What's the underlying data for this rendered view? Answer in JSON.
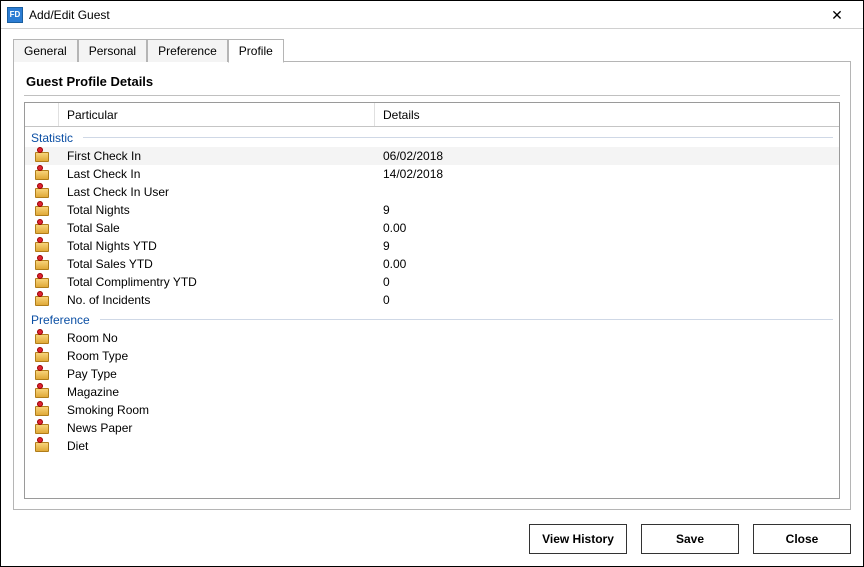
{
  "window": {
    "title": "Add/Edit Guest",
    "app_icon_text": "FD"
  },
  "tabs": [
    {
      "label": "General"
    },
    {
      "label": "Personal"
    },
    {
      "label": "Preference"
    },
    {
      "label": "Profile"
    }
  ],
  "active_tab_index": 3,
  "panel": {
    "title": "Guest Profile Details",
    "columns": {
      "particular": "Particular",
      "details": "Details"
    },
    "groups": [
      {
        "name": "Statistic",
        "rows": [
          {
            "particular": "First Check In",
            "details": "06/02/2018"
          },
          {
            "particular": "Last Check In",
            "details": "14/02/2018"
          },
          {
            "particular": "Last Check In User",
            "details": ""
          },
          {
            "particular": "Total Nights",
            "details": "9"
          },
          {
            "particular": "Total Sale",
            "details": "0.00"
          },
          {
            "particular": "Total Nights YTD",
            "details": "9"
          },
          {
            "particular": "Total Sales YTD",
            "details": "0.00"
          },
          {
            "particular": "Total Complimentry YTD",
            "details": "0"
          },
          {
            "particular": "No. of Incidents",
            "details": "0"
          }
        ]
      },
      {
        "name": "Preference",
        "rows": [
          {
            "particular": "Room No",
            "details": ""
          },
          {
            "particular": "Room Type",
            "details": ""
          },
          {
            "particular": "Pay Type",
            "details": ""
          },
          {
            "particular": "Magazine",
            "details": ""
          },
          {
            "particular": "Smoking Room",
            "details": ""
          },
          {
            "particular": "News Paper",
            "details": ""
          },
          {
            "particular": "Diet",
            "details": ""
          }
        ]
      }
    ]
  },
  "footer": {
    "view_history": "View History",
    "save": "Save",
    "close": "Close"
  }
}
